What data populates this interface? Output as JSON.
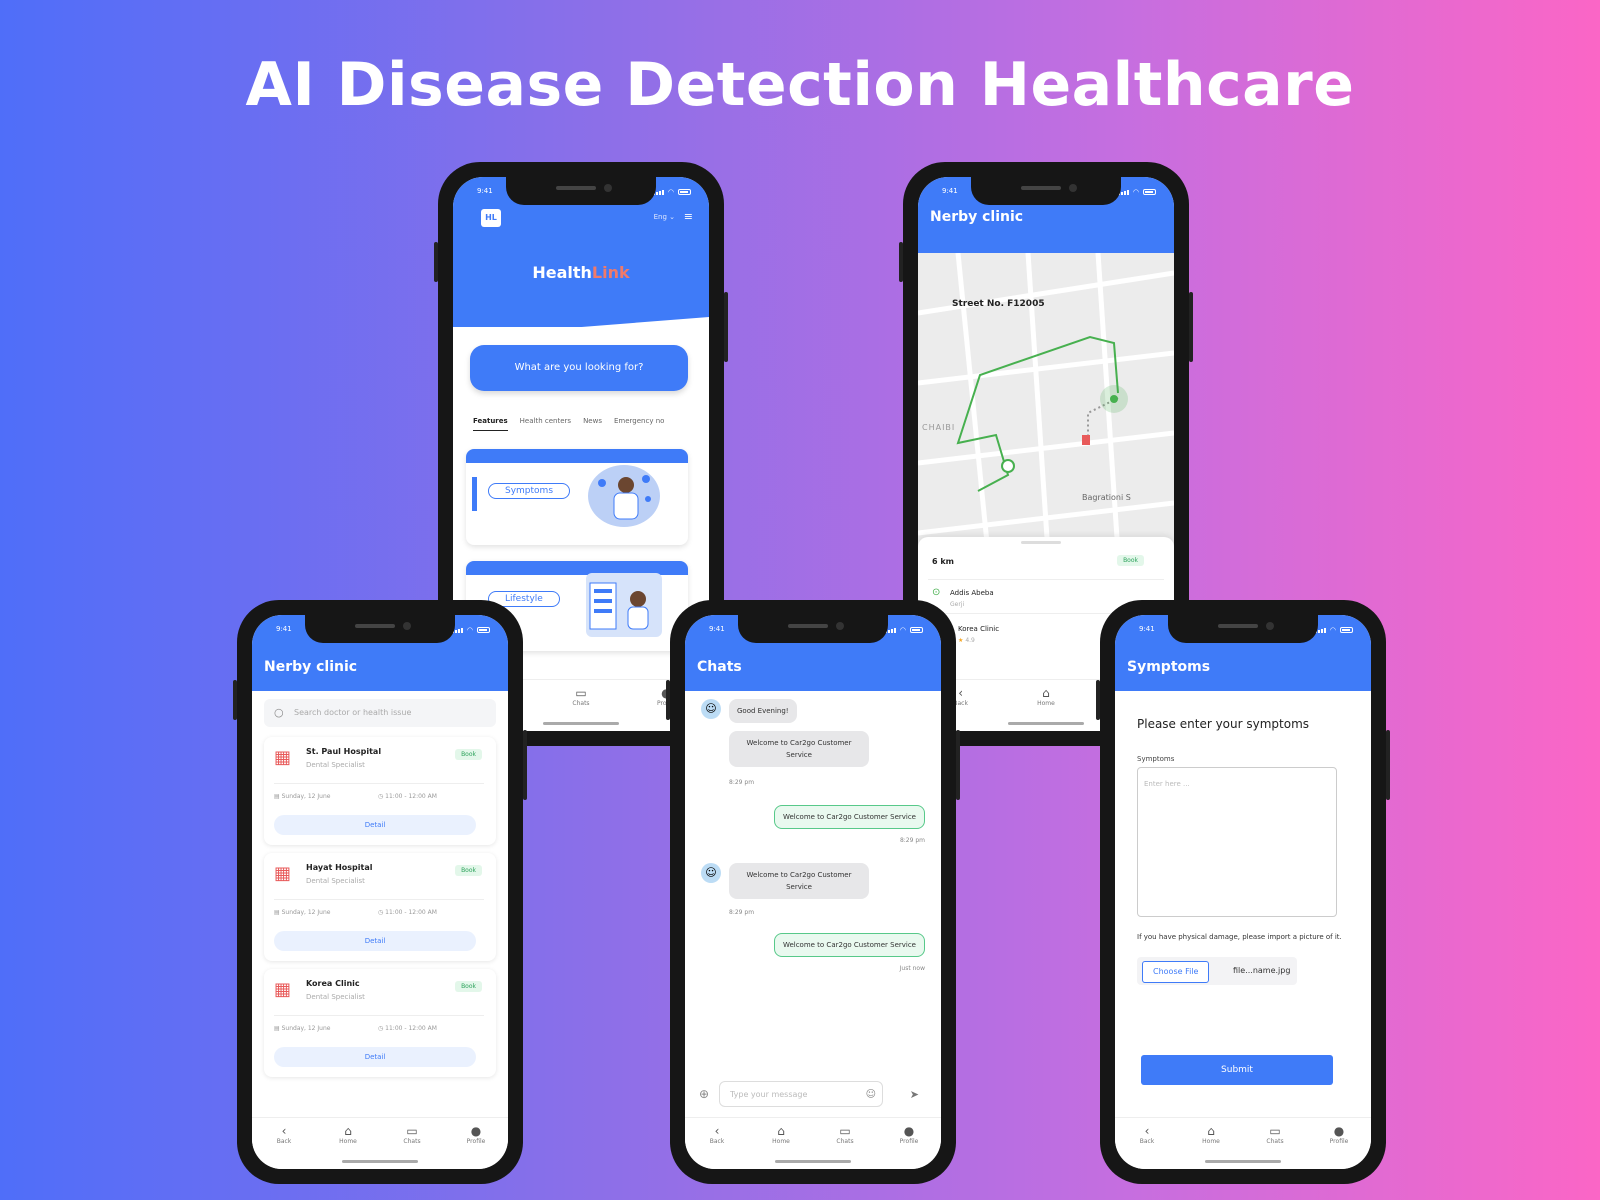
{
  "page": {
    "title": "AI Disease Detection Healthcare"
  },
  "status": {
    "time": "9:41"
  },
  "home": {
    "logo": "HL",
    "lang": "Eng",
    "brand_a": "Health",
    "brand_b": "Link",
    "search": "What are you looking for?",
    "tabs": [
      "Features",
      "Health centers",
      "News",
      "Emergency no"
    ],
    "card1": "Symptoms",
    "card2": "Lifestyle"
  },
  "map": {
    "title": "Nerby clinic",
    "street": "Street No. F12005",
    "district": "CHAIBI",
    "road": "Bagrationi S",
    "distance": "6 km",
    "book": "Book",
    "place": "Addis Abeba",
    "place_sub": "Gerji",
    "clinic": "Korea Clinic",
    "rating": "4.9"
  },
  "clinics": {
    "title": "Nerby clinic",
    "search_placeholder": "Search doctor or health issue",
    "items": [
      {
        "name": "St. Paul Hospital",
        "spec": "Dental Specialist",
        "book": "Book",
        "date": "Sunday, 12 June",
        "time": "11:00 - 12:00 AM",
        "detail": "Detail"
      },
      {
        "name": "Hayat Hospital",
        "spec": "Dental Specialist",
        "book": "Book",
        "date": "Sunday, 12 June",
        "time": "11:00 - 12:00 AM",
        "detail": "Detail"
      },
      {
        "name": "Korea Clinic",
        "spec": "Dental Specialist",
        "book": "Book",
        "date": "Sunday, 12 June",
        "time": "11:00 - 12:00 AM",
        "detail": "Detail"
      }
    ]
  },
  "chat": {
    "title": "Chats",
    "m1": "Good Evening!",
    "m2": "Welcome to Car2go Customer Service",
    "t1": "8:29 pm",
    "m3": "Welcome to Car2go Customer Service",
    "t2": "8:29 pm",
    "m4": "Welcome to Car2go Customer Service",
    "t3": "8:29 pm",
    "m5": "Welcome to Car2go Customer Service",
    "t4": "Just now",
    "placeholder": "Type your message"
  },
  "symptoms": {
    "title": "Symptoms",
    "heading": "Please enter your symptoms",
    "label": "Symptoms",
    "placeholder": "Enter here ...",
    "note": "If you have physical damage, please import a picture of it.",
    "choose": "Choose File",
    "file": "file...name.jpg",
    "submit": "Submit"
  },
  "tabbar": {
    "back": "Back",
    "home": "Home",
    "chats": "Chats",
    "profile": "Profile"
  },
  "colors": {
    "primary": "#3f7bf8",
    "accent": "#f07a6a",
    "success": "#2ba15a"
  }
}
